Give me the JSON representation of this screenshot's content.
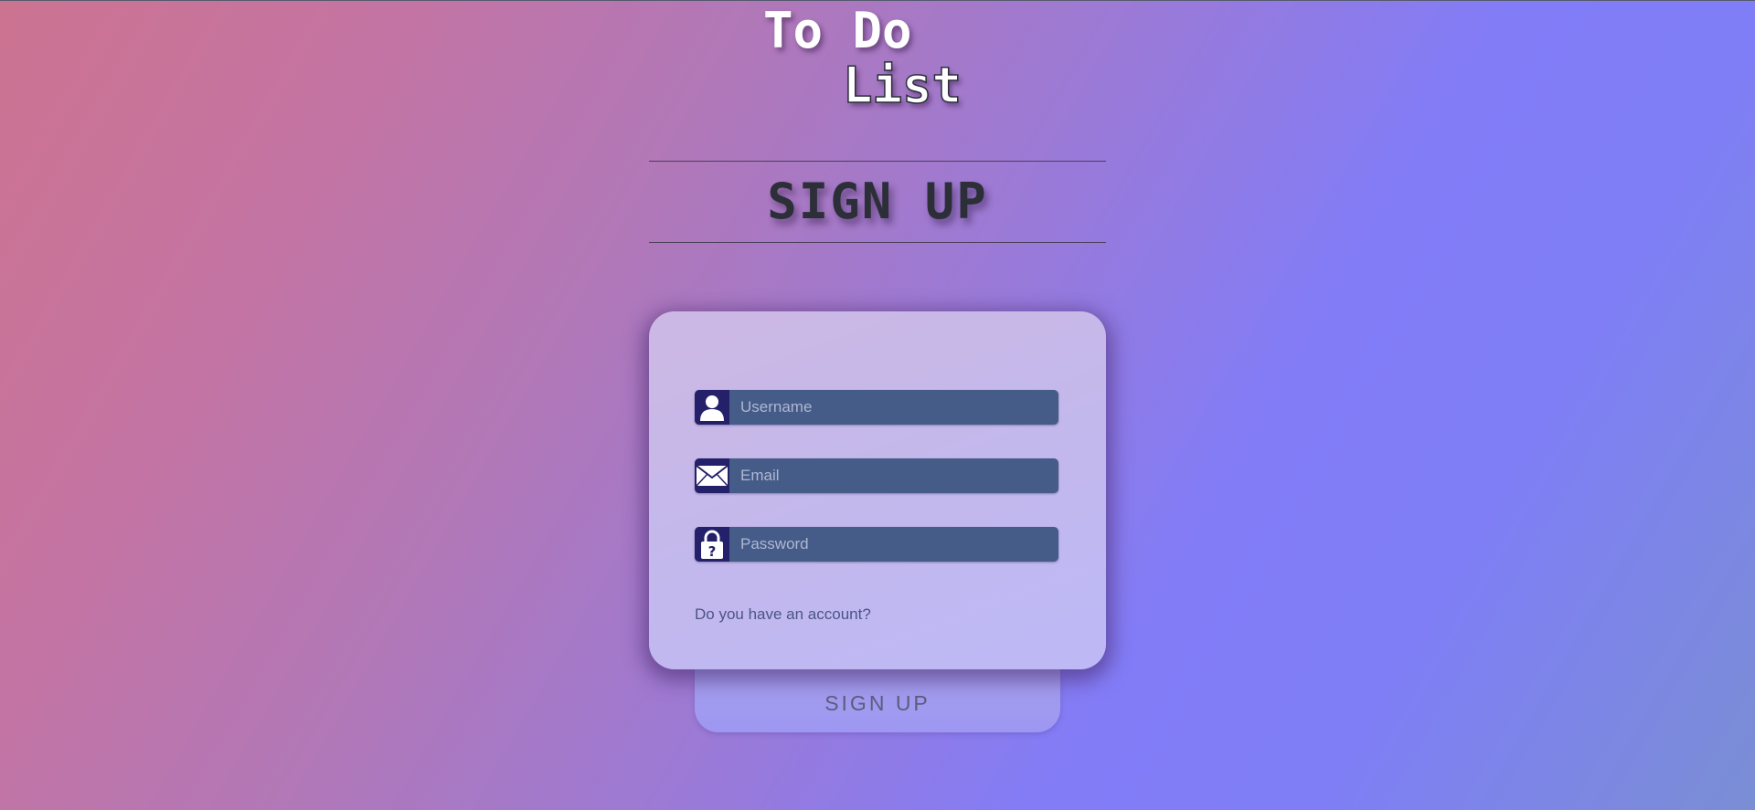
{
  "logo": {
    "line1": "To Do",
    "line2": "List"
  },
  "page_heading": "SIGN UP",
  "form": {
    "fields": [
      {
        "icon": "user-icon",
        "placeholder": "Username",
        "value": ""
      },
      {
        "icon": "envelope-icon",
        "placeholder": "Email",
        "value": ""
      },
      {
        "icon": "lock-question-icon",
        "placeholder": "Password",
        "value": ""
      }
    ],
    "account_link": "Do you have an account?",
    "submit_label": "SIGN UP"
  },
  "colors": {
    "gradient_start": "#cc7390",
    "gradient_mid": "#827cf7",
    "gradient_end": "#7a8ed4",
    "card": "#c3b8ec",
    "input_bg": "#455b88",
    "icon_bg": "#25206a",
    "heading_text": "#2c2f38"
  }
}
